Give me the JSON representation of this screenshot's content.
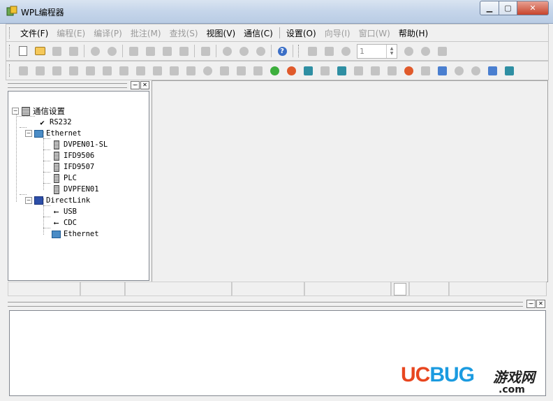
{
  "window": {
    "title": "WPL编程器"
  },
  "menu": [
    {
      "label": "文件(F)",
      "disabled": false
    },
    {
      "label": "编程(E)",
      "disabled": true
    },
    {
      "label": "编译(P)",
      "disabled": true
    },
    {
      "label": "批注(M)",
      "disabled": true
    },
    {
      "label": "查找(S)",
      "disabled": true
    },
    {
      "label": "视图(V)",
      "disabled": false
    },
    {
      "label": "通信(C)",
      "disabled": false
    },
    {
      "label": "设置(O)",
      "disabled": false
    },
    {
      "label": "向导(I)",
      "disabled": true
    },
    {
      "label": "窗口(W)",
      "disabled": true
    },
    {
      "label": "帮助(H)",
      "disabled": false
    }
  ],
  "toolbar1": {
    "spin_value": "1",
    "icons": [
      "new-file-icon",
      "open-folder-icon",
      "save-icon",
      "save-all-icon",
      "print-icon",
      "print-preview-icon",
      "cut-icon",
      "copy-icon",
      "paste-icon",
      "erase-icon",
      "undo-icon",
      "zoom-icon",
      "zoom-in-icon",
      "zoom-out-icon",
      "help-icon",
      "compile-icon",
      "decompile-icon",
      "monitor-icon",
      "step-icon",
      "stop-icon",
      "refresh-icon",
      "run-icon"
    ]
  },
  "toolbar2": {
    "icons": [
      "contact-no-icon",
      "contact-nc-icon",
      "rising-icon",
      "falling-icon",
      "coil-icon",
      "function-icon",
      "table-icon",
      "list-icon",
      "edit-icon",
      "comment-icon",
      "note-icon",
      "marker-icon",
      "block-icon",
      "block2-icon",
      "block3-icon",
      "run-green-icon",
      "stop-red-icon",
      "download-icon",
      "upload-icon",
      "compare-icon",
      "network-icon",
      "network2-icon",
      "network3-icon",
      "network4-icon",
      "network5-icon",
      "image-icon",
      "search-icon",
      "search2-icon",
      "computer-icon",
      "link-icon"
    ]
  },
  "tree": {
    "root": "通信设置",
    "rs232": "RS232",
    "ethernet": "Ethernet",
    "eth_children": [
      "DVPEN01-SL",
      "IFD9506",
      "IFD9507",
      "PLC",
      "DVPFEN01"
    ],
    "directlink": "DirectLink",
    "dl_children": [
      "USB",
      "CDC",
      "Ethernet"
    ]
  },
  "pane_buttons": {
    "pin": "ᅲ",
    "close": "✕"
  },
  "watermark": {
    "uc": "UC",
    "bug": "BUG",
    "cn": "游戏网",
    "domain": ".com"
  }
}
